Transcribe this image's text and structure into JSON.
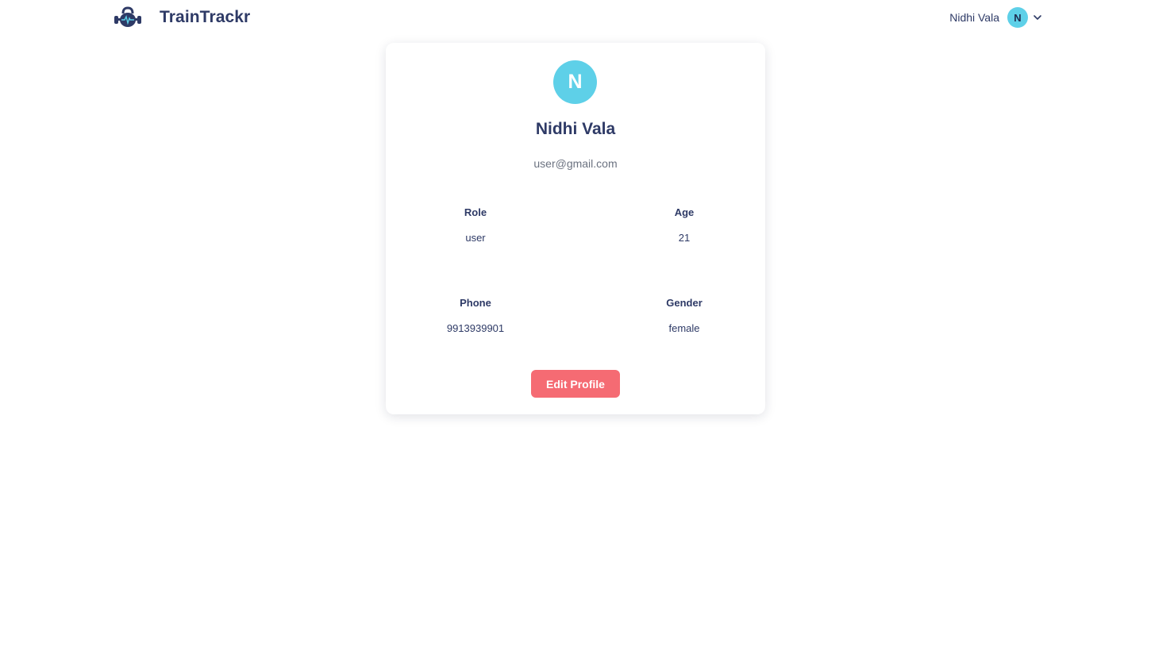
{
  "header": {
    "brand_name": "TrainTrackr",
    "brand_logo_icon": "kettlebell-heartbeat-icon",
    "user_name": "Nidhi Vala",
    "user_initial": "N",
    "menu_icon": "chevron-down-icon"
  },
  "profile": {
    "initial": "N",
    "name": "Nidhi Vala",
    "email": "user@gmail.com",
    "fields": [
      {
        "label": "Role",
        "value": "user"
      },
      {
        "label": "Age",
        "value": "21"
      },
      {
        "label": "Phone",
        "value": "9913939901"
      },
      {
        "label": "Gender",
        "value": "female"
      }
    ],
    "edit_label": "Edit Profile"
  },
  "colors": {
    "primary_text": "#2e3a66",
    "avatar": "#5ed0e8",
    "edit_button": "#f56b73",
    "muted_text": "#6b7280"
  }
}
